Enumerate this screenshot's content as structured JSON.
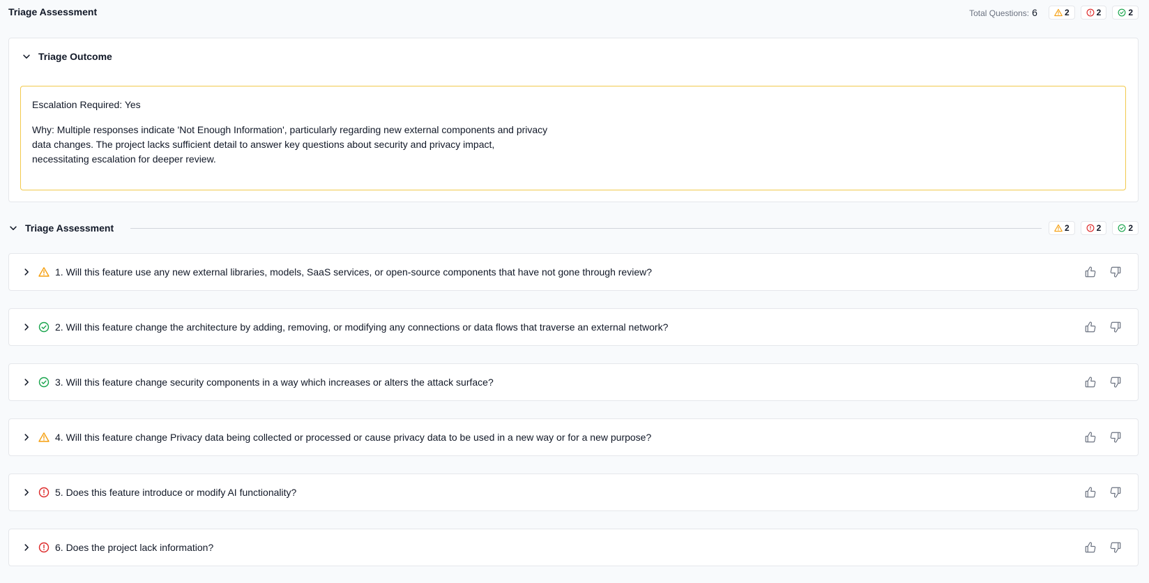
{
  "header": {
    "title": "Triage Assessment",
    "total_label": "Total Questions:",
    "total_value": "6",
    "badges": {
      "warning": "2",
      "error": "2",
      "success": "2"
    }
  },
  "outcome": {
    "title": "Triage Outcome",
    "escalation": "Escalation Required: Yes",
    "why": "Why: Multiple responses indicate 'Not Enough Information', particularly regarding new external components and privacy data changes. The project lacks sufficient detail to answer key questions about security and privacy impact, necessitating escalation for deeper review."
  },
  "assessment": {
    "title": "Triage Assessment",
    "badges": {
      "warning": "2",
      "error": "2",
      "success": "2"
    },
    "questions": [
      {
        "text": "1. Will this feature use any new external libraries, models, SaaS services, or open-source components that have not gone through review?",
        "status": "warning"
      },
      {
        "text": "2. Will this feature change the architecture by adding, removing, or modifying any connections or data flows that traverse an external network?",
        "status": "success"
      },
      {
        "text": "3. Will this feature change security components in a way which increases or alters the attack surface?",
        "status": "success"
      },
      {
        "text": "4. Will this feature change Privacy data being collected or processed or cause privacy data to be used in a new way or for a new purpose?",
        "status": "warning"
      },
      {
        "text": "5. Does this feature introduce or modify AI functionality?",
        "status": "error"
      },
      {
        "text": "6. Does the project lack information?",
        "status": "error"
      }
    ]
  },
  "colors": {
    "warning": "#f59e0b",
    "error": "#dc2626",
    "success": "#16a34a",
    "outcome_border": "#f2c94c"
  },
  "icons": {
    "warning": "warning-triangle-icon",
    "error": "alert-circle-icon",
    "success": "check-circle-icon",
    "expand": "chevron-right-icon",
    "collapse": "chevron-down-icon",
    "like": "thumbs-up-icon",
    "dislike": "thumbs-down-icon"
  }
}
